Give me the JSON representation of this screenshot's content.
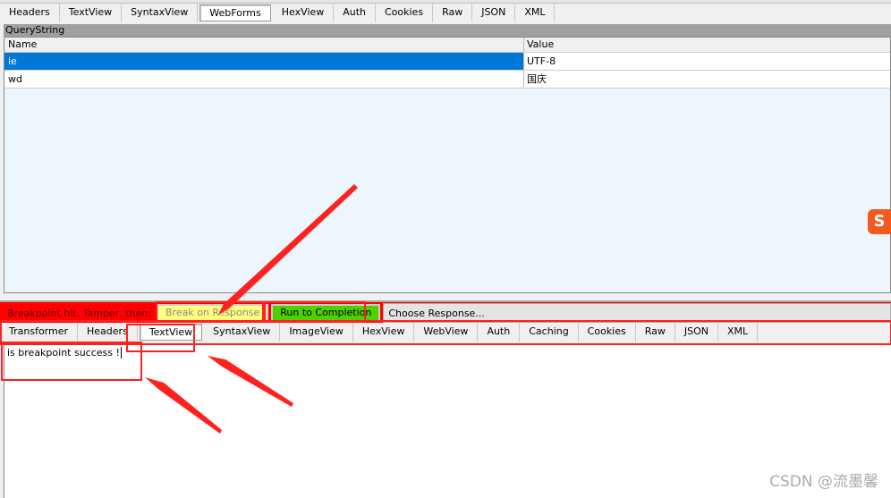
{
  "request_tabs": [
    "Headers",
    "TextView",
    "SyntaxView",
    "WebForms",
    "HexView",
    "Auth",
    "Cookies",
    "Raw",
    "JSON",
    "XML"
  ],
  "request_selected": "WebForms",
  "querystring": {
    "title": "QueryString",
    "columns": [
      "Name",
      "Value"
    ],
    "rows": [
      {
        "name": "ie",
        "value": "UTF-8"
      },
      {
        "name": "wd",
        "value": "国庆"
      }
    ]
  },
  "breakpoint": {
    "label": "Breakpoint hit. Tamper, then:",
    "break_on_response": "Break on Response",
    "run_to_completion": "Run to Completion",
    "choose_response": "Choose Response..."
  },
  "response_tabs": [
    "Transformer",
    "Headers",
    "TextView",
    "SyntaxView",
    "ImageView",
    "HexView",
    "WebView",
    "Auth",
    "Caching",
    "Cookies",
    "Raw",
    "JSON",
    "XML"
  ],
  "response_selected": "TextView",
  "response_text": "is  breakpoint success !",
  "watermark": "CSDN @流墨馨",
  "colors": {
    "selection": "#0078d7",
    "breakpoint_bar": "#ff0000",
    "run_button": "#50d000",
    "break_button": "#ffff80",
    "annotation": "#ff2020"
  }
}
